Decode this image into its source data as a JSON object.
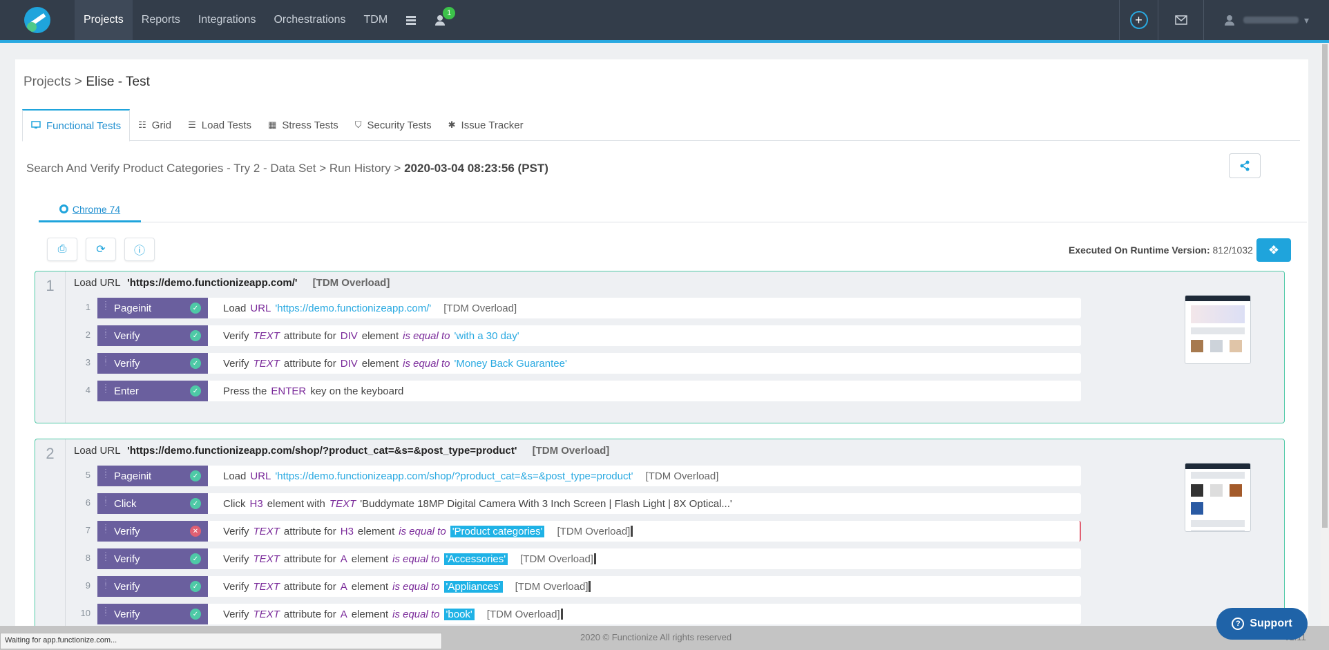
{
  "nav": {
    "items": [
      {
        "label": "Projects",
        "active": true
      },
      {
        "label": "Reports"
      },
      {
        "label": "Integrations"
      },
      {
        "label": "Orchestrations"
      },
      {
        "label": "TDM"
      }
    ],
    "notification_count": "1"
  },
  "breadcrumb": {
    "root": "Projects",
    "sep": ">",
    "current": "Elise - Test"
  },
  "tabs": [
    {
      "label": "Functional Tests",
      "icon": "monitor-icon",
      "active": true
    },
    {
      "label": "Grid",
      "icon": "grid-icon"
    },
    {
      "label": "Load Tests",
      "icon": "load-icon"
    },
    {
      "label": "Stress Tests",
      "icon": "stress-icon"
    },
    {
      "label": "Security Tests",
      "icon": "shield-icon"
    },
    {
      "label": "Issue Tracker",
      "icon": "bug-icon"
    }
  ],
  "run": {
    "path": "Search And Verify Product Categories - Try 2 - Data Set > Run History >",
    "timestamp": "2020-03-04 08:23:56 (PST)"
  },
  "browser_tab": {
    "label": "Chrome 74"
  },
  "runtime": {
    "label": "Executed On Runtime Version:",
    "value": "812/1032"
  },
  "groups": [
    {
      "num": "1",
      "head_kw": "Load",
      "head_url_kw": "URL",
      "head_url": "'https://demo.functionizeapp.com/'",
      "head_tdm": "[TDM Overload]",
      "steps": [
        {
          "num": "1",
          "action": "Pageinit",
          "status": "ok",
          "parts": {
            "t1": "Load",
            "k1": "URL",
            "v1": "'https://demo.functionizeapp.com/'",
            "tdm": "[TDM Overload]"
          }
        },
        {
          "num": "2",
          "action": "Verify",
          "status": "ok",
          "parts": {
            "t1": "Verify",
            "i1": "TEXT",
            "t2": "attribute for",
            "k1": "DIV",
            "t3": "element",
            "i2": "is equal to",
            "v1": "'with a 30 day'"
          }
        },
        {
          "num": "3",
          "action": "Verify",
          "status": "ok",
          "parts": {
            "t1": "Verify",
            "i1": "TEXT",
            "t2": "attribute for",
            "k1": "DIV",
            "t3": "element",
            "i2": "is equal to",
            "v1": "'Money Back Guarantee'"
          }
        },
        {
          "num": "4",
          "action": "Enter",
          "status": "ok",
          "parts": {
            "t1": "Press the",
            "k1": "ENTER",
            "t2": "key on the keyboard"
          }
        }
      ]
    },
    {
      "num": "2",
      "head_kw": "Load",
      "head_url_kw": "URL",
      "head_url": "'https://demo.functionizeapp.com/shop/?product_cat=&s=&post_type=product'",
      "head_tdm": "[TDM Overload]",
      "steps": [
        {
          "num": "5",
          "action": "Pageinit",
          "status": "ok",
          "parts": {
            "t1": "Load",
            "k1": "URL",
            "v1": "'https://demo.functionizeapp.com/shop/?product_cat=&s=&post_type=product'",
            "tdm": "[TDM Overload]"
          }
        },
        {
          "num": "6",
          "action": "Click",
          "status": "ok",
          "parts": {
            "t1": "Click",
            "k1": "H3",
            "t2": "element with",
            "i1": "TEXT",
            "t3": "'Buddymate 18MP Digital Camera With 3 Inch Screen | Flash Light | 8X Optical...'"
          }
        },
        {
          "num": "7",
          "action": "Verify",
          "status": "fail",
          "parts": {
            "t1": "Verify",
            "i1": "TEXT",
            "t2": "attribute for",
            "k1": "H3",
            "t3": "element",
            "i2": "is equal to",
            "h1": "'Product categories'",
            "tdm": "[TDM Overload]"
          }
        },
        {
          "num": "8",
          "action": "Verify",
          "status": "ok",
          "parts": {
            "t1": "Verify",
            "i1": "TEXT",
            "t2": "attribute for",
            "k1": "A",
            "t3": "element",
            "i2": "is equal to",
            "h1": "'Accessories'",
            "tdm": "[TDM Overload]"
          }
        },
        {
          "num": "9",
          "action": "Verify",
          "status": "ok",
          "parts": {
            "t1": "Verify",
            "i1": "TEXT",
            "t2": "attribute for",
            "k1": "A",
            "t3": "element",
            "i2": "is equal to",
            "h1": "'Appliances'",
            "tdm": "[TDM Overload]"
          }
        },
        {
          "num": "10",
          "action": "Verify",
          "status": "ok",
          "parts": {
            "t1": "Verify",
            "i1": "TEXT",
            "t2": "attribute for",
            "k1": "A",
            "t3": "element",
            "i2": "is equal to",
            "h1": "'book'",
            "tdm": "[TDM Overload]"
          }
        }
      ]
    }
  ],
  "footer": {
    "copyright": "2020 © Functionize All rights reserved",
    "version": "v1.11"
  },
  "status_bar": "Waiting for app.functionize.com...",
  "support": {
    "label": "Support"
  },
  "colors": {
    "nav_bg": "#333d4a",
    "accent": "#1fa4dc",
    "badge": "#6a5f9e",
    "ok": "#4ec9a6",
    "fail": "#e06072",
    "keyword": "#7a2a9a"
  }
}
